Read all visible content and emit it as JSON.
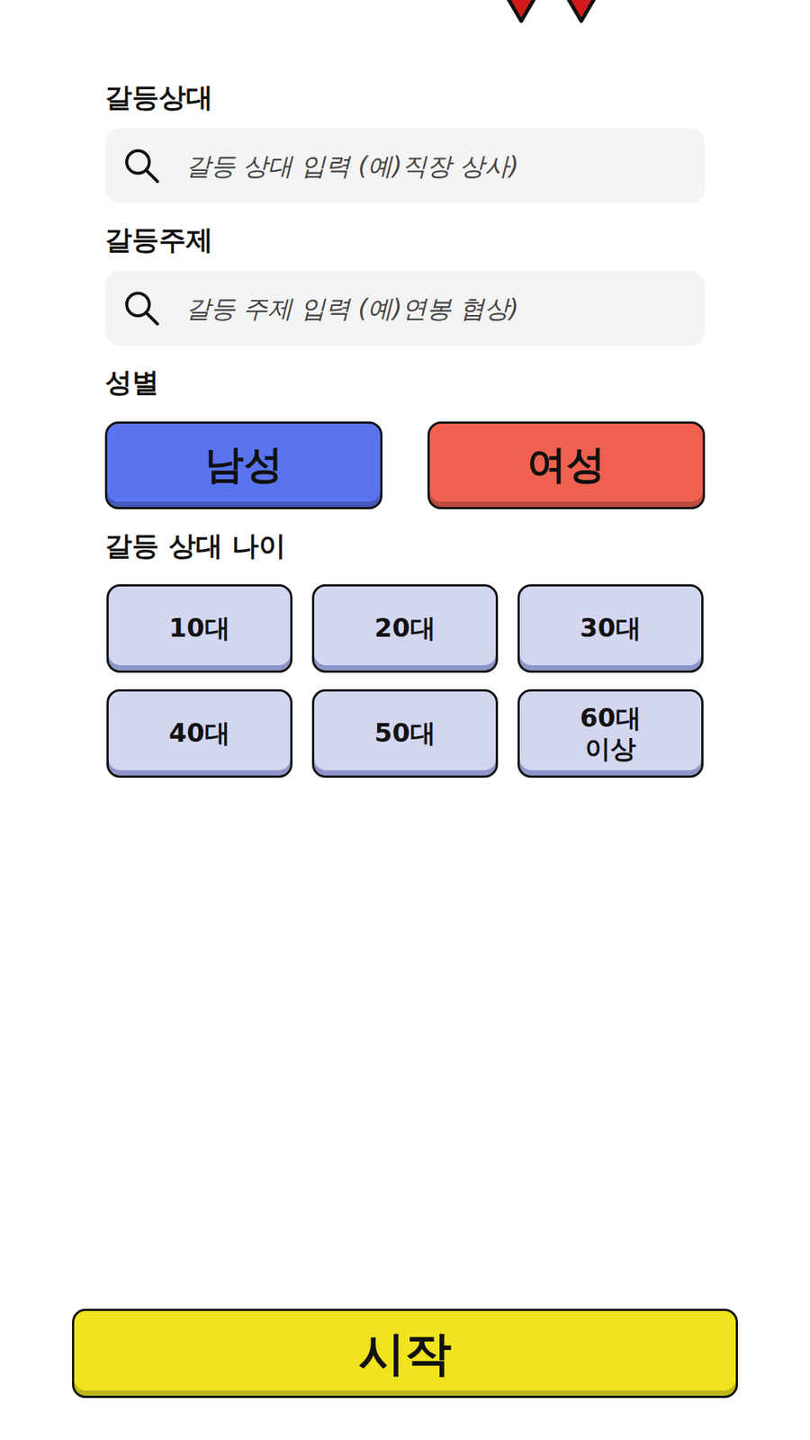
{
  "fields": [
    {
      "label": "갈등상대",
      "placeholder": "갈등 상대 입력 (예)직장 상사)"
    },
    {
      "label": "갈등주제",
      "placeholder": "갈등 주제 입력 (예)연봉 협상)"
    }
  ],
  "gender": {
    "label": "성별",
    "options": [
      {
        "label": "남성",
        "selected": false,
        "color": "#5a74f0"
      },
      {
        "label": "여성",
        "selected": false,
        "color": "#f0614f"
      }
    ]
  },
  "age": {
    "label": "갈등 상대 나이",
    "options": [
      {
        "label": "10대",
        "selected": false
      },
      {
        "label": "20대",
        "selected": false
      },
      {
        "label": "30대",
        "selected": false
      },
      {
        "label": "40대",
        "selected": false
      },
      {
        "label": "50대",
        "selected": false
      },
      {
        "label": "60대\n이상",
        "selected": false
      }
    ]
  },
  "start_button": {
    "label": "시작"
  }
}
